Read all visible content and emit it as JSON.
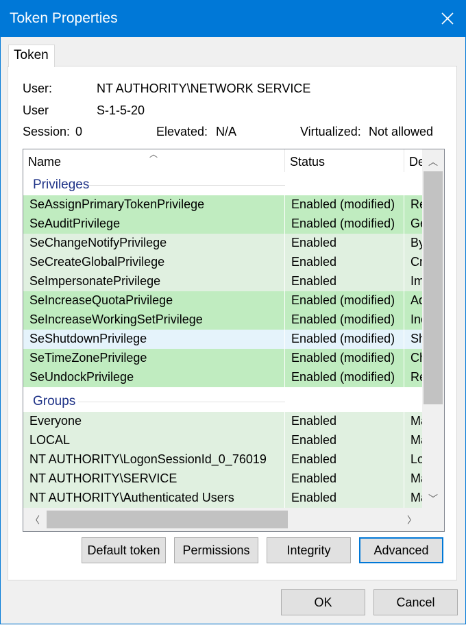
{
  "window": {
    "title": "Token Properties"
  },
  "tabs": [
    {
      "label": "Token"
    }
  ],
  "info": {
    "user_label": "User:",
    "user_value": "NT AUTHORITY\\NETWORK SERVICE",
    "sid_label": "User",
    "sid_value": "S-1-5-20",
    "session_label": "Session:",
    "session_value": "0",
    "elevated_label": "Elevated:",
    "elevated_value": "N/A",
    "virtualized_label": "Virtualized:",
    "virtualized_value": "Not allowed"
  },
  "list": {
    "columns": [
      "Name",
      "Status",
      "De"
    ],
    "groups": [
      {
        "title": "Privileges",
        "rows": [
          {
            "name": "SeAssignPrimaryTokenPrivilege",
            "status": "Enabled (modified)",
            "desc": "Re",
            "state": "modified"
          },
          {
            "name": "SeAuditPrivilege",
            "status": "Enabled (modified)",
            "desc": "Ge",
            "state": "modified"
          },
          {
            "name": "SeChangeNotifyPrivilege",
            "status": "Enabled",
            "desc": "By",
            "state": "enabled"
          },
          {
            "name": "SeCreateGlobalPrivilege",
            "status": "Enabled",
            "desc": "Cr",
            "state": "enabled"
          },
          {
            "name": "SeImpersonatePrivilege",
            "status": "Enabled",
            "desc": "Im",
            "state": "enabled"
          },
          {
            "name": "SeIncreaseQuotaPrivilege",
            "status": "Enabled (modified)",
            "desc": "Ad",
            "state": "modified"
          },
          {
            "name": "SeIncreaseWorkingSetPrivilege",
            "status": "Enabled (modified)",
            "desc": "Inc",
            "state": "modified"
          },
          {
            "name": "SeShutdownPrivilege",
            "status": "Enabled (modified)",
            "desc": "Sh",
            "state": "selected"
          },
          {
            "name": "SeTimeZonePrivilege",
            "status": "Enabled (modified)",
            "desc": "Ch",
            "state": "modified"
          },
          {
            "name": "SeUndockPrivilege",
            "status": "Enabled (modified)",
            "desc": "Re",
            "state": "modified"
          }
        ]
      },
      {
        "title": "Groups",
        "rows": [
          {
            "name": "Everyone",
            "status": "Enabled",
            "desc": "Ma",
            "state": "enabled"
          },
          {
            "name": "LOCAL",
            "status": "Enabled",
            "desc": "Ma",
            "state": "enabled"
          },
          {
            "name": "NT AUTHORITY\\LogonSessionId_0_76019",
            "status": "Enabled",
            "desc": "Lo",
            "state": "enabled"
          },
          {
            "name": "NT AUTHORITY\\SERVICE",
            "status": "Enabled",
            "desc": "Ma",
            "state": "enabled"
          },
          {
            "name": "NT AUTHORITY\\Authenticated Users",
            "status": "Enabled",
            "desc": "Ma",
            "state": "enabled"
          }
        ]
      }
    ]
  },
  "buttons": {
    "default_token": "Default token",
    "permissions": "Permissions",
    "integrity": "Integrity",
    "advanced": "Advanced",
    "ok": "OK",
    "cancel": "Cancel"
  },
  "colors": {
    "titlebar": "#0078d7",
    "modified": "#c0ecc0",
    "enabled": "#e0f0e0",
    "selected": "#e5f3fb",
    "group_title": "#1e3287"
  },
  "icons": {
    "close": "close-icon",
    "sort": "sort-up-icon"
  }
}
